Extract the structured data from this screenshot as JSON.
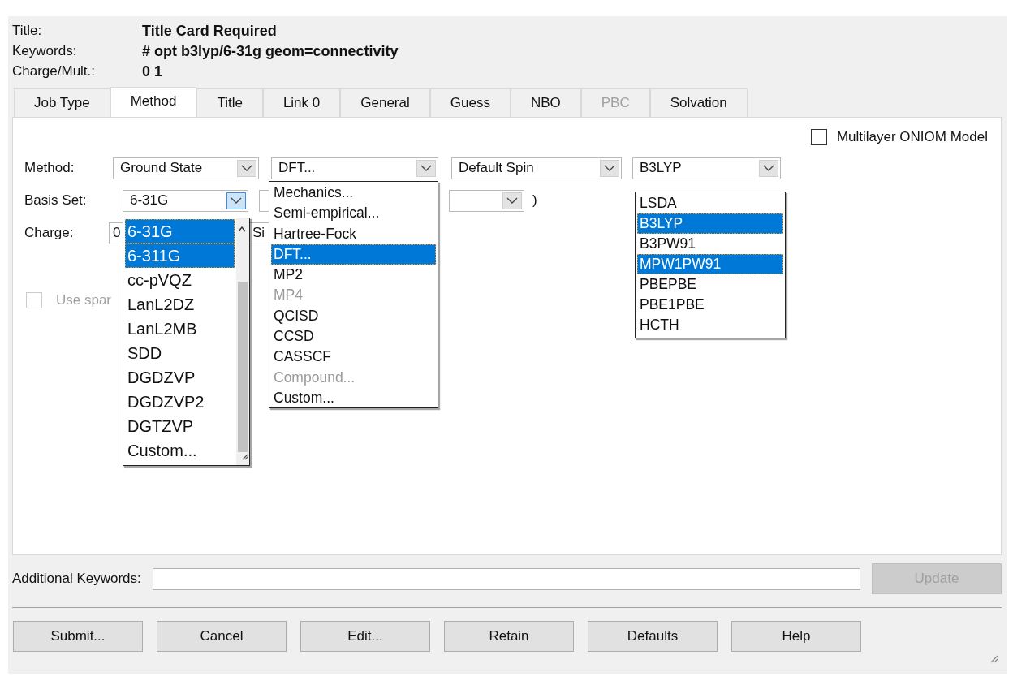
{
  "header": [
    {
      "label": "Title:",
      "value": "Title Card Required"
    },
    {
      "label": "Keywords:",
      "value": "# opt b3lyp/6-31g geom=connectivity"
    },
    {
      "label": "Charge/Mult.:",
      "value": "0 1"
    }
  ],
  "tabs": [
    {
      "label": "Job Type",
      "selected": false,
      "disabled": false
    },
    {
      "label": "Method",
      "selected": true,
      "disabled": false
    },
    {
      "label": "Title",
      "selected": false,
      "disabled": false
    },
    {
      "label": "Link 0",
      "selected": false,
      "disabled": false
    },
    {
      "label": "General",
      "selected": false,
      "disabled": false
    },
    {
      "label": "Guess",
      "selected": false,
      "disabled": false
    },
    {
      "label": "NBO",
      "selected": false,
      "disabled": false
    },
    {
      "label": "PBC",
      "selected": false,
      "disabled": true
    },
    {
      "label": "Solvation",
      "selected": false,
      "disabled": false
    }
  ],
  "multilayer": {
    "label": "Multilayer ONIOM Model",
    "checked": false
  },
  "method_row": {
    "label": "Method:",
    "combos": [
      {
        "value": "Ground State",
        "expanded": false
      },
      {
        "value": "DFT...",
        "expanded": false
      },
      {
        "value": "Default Spin",
        "expanded": false
      },
      {
        "value": "B3LYP",
        "expanded": false
      }
    ]
  },
  "basis_row": {
    "label": "Basis Set:",
    "combo": {
      "value": "6-31G",
      "expanded": true
    },
    "close_paren": ")"
  },
  "charge_row": {
    "label": "Charge:",
    "charge": "0",
    "multiplicity": "Si"
  },
  "sparse": {
    "label": "Use spar",
    "checked": false,
    "disabled": true
  },
  "basis_list": [
    {
      "label": "6-31G",
      "selected": true
    },
    {
      "label": "6-311G",
      "selected": true
    },
    {
      "label": "cc-pVQZ",
      "selected": false
    },
    {
      "label": "LanL2DZ",
      "selected": false
    },
    {
      "label": "LanL2MB",
      "selected": false
    },
    {
      "label": "SDD",
      "selected": false
    },
    {
      "label": "DGDZVP",
      "selected": false
    },
    {
      "label": "DGDZVP2",
      "selected": false
    },
    {
      "label": "DGTZVP",
      "selected": false
    },
    {
      "label": "Custom...",
      "selected": false
    }
  ],
  "method_list": [
    {
      "label": "Mechanics...",
      "selected": false,
      "disabled": false
    },
    {
      "label": "Semi-empirical...",
      "selected": false,
      "disabled": false
    },
    {
      "label": "Hartree-Fock",
      "selected": false,
      "disabled": false
    },
    {
      "label": "DFT...",
      "selected": true,
      "disabled": false
    },
    {
      "label": "MP2",
      "selected": false,
      "disabled": false
    },
    {
      "label": "MP4",
      "selected": false,
      "disabled": true
    },
    {
      "label": "QCISD",
      "selected": false,
      "disabled": false
    },
    {
      "label": "CCSD",
      "selected": false,
      "disabled": false
    },
    {
      "label": "CASSCF",
      "selected": false,
      "disabled": false
    },
    {
      "label": "Compound...",
      "selected": false,
      "disabled": true
    },
    {
      "label": "Custom...",
      "selected": false,
      "disabled": false
    }
  ],
  "functional_list": [
    {
      "label": "LSDA",
      "selected": false
    },
    {
      "label": "B3LYP",
      "selected": true
    },
    {
      "label": "B3PW91",
      "selected": false
    },
    {
      "label": "MPW1PW91",
      "selected": true
    },
    {
      "label": "PBEPBE",
      "selected": false
    },
    {
      "label": "PBE1PBE",
      "selected": false
    },
    {
      "label": "HCTH",
      "selected": false
    }
  ],
  "additional_keywords": {
    "label": "Additional Keywords:"
  },
  "update_button": {
    "label": "Update",
    "disabled": true
  },
  "buttons": [
    "Submit...",
    "Cancel",
    "Edit...",
    "Retain",
    "Defaults",
    "Help"
  ]
}
